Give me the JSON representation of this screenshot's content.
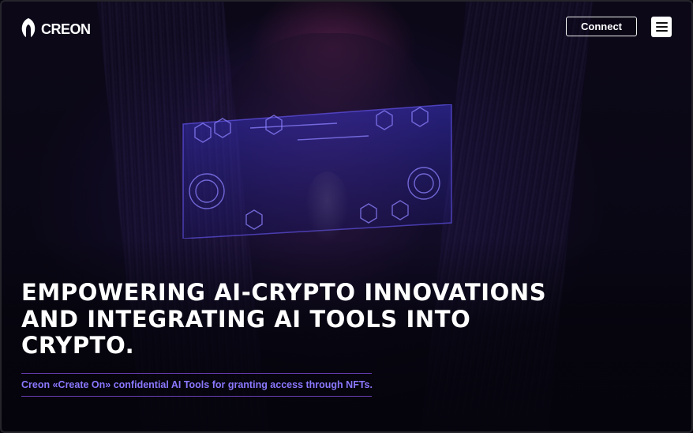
{
  "brand": {
    "name": "CREON",
    "logo_icon": "creon-logo-icon"
  },
  "header": {
    "connect_label": "Connect",
    "menu_icon": "hamburger-menu-icon"
  },
  "hero": {
    "headline_lines": [
      "EMPOWERING AI-CRYPTO INNOVATIONS",
      "AND INTEGRATING AI TOOLS INTO",
      "CRYPTO."
    ],
    "tagline": "Creon «Create On» confidential AI Tools for granting access through NFTs."
  },
  "colors": {
    "background": "#05040c",
    "accent_text": "#8a78ff",
    "accent_border": "#6a3fb6",
    "visor_glow": "#6a5cff"
  }
}
